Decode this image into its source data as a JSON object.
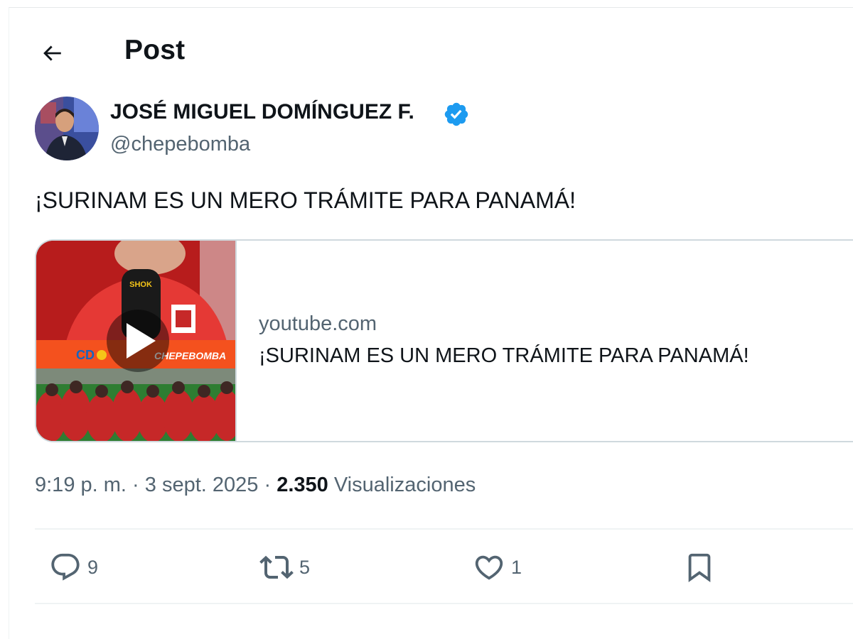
{
  "header": {
    "title": "Post",
    "back_icon": "arrow-left-icon"
  },
  "author": {
    "name": "JOSÉ MIGUEL DOMÍNGUEZ F.",
    "handle": "@chepebomba",
    "verified": true,
    "verified_color": "#1d9bf0"
  },
  "post": {
    "text": "¡SURINAM ES UN MERO TRÁMITE PARA PANAMÁ!"
  },
  "card": {
    "domain": "youtube.com",
    "title": "¡SURINAM ES UN MERO TRÁMITE PARA PANAMÁ!",
    "thumbnail_labels": {
      "mic": "SHOK",
      "banner": "CHEPEBOMBA",
      "logo": "CD"
    },
    "play_icon": "play-icon"
  },
  "meta": {
    "time": "9:19 p. m.",
    "separator": "·",
    "date": "3 sept. 2025",
    "views": "2.350",
    "views_label": "Visualizaciones"
  },
  "actions": {
    "replies": "9",
    "reposts": "5",
    "likes": "1",
    "reply_icon": "reply-icon",
    "repost_icon": "repost-icon",
    "like_icon": "heart-icon",
    "bookmark_icon": "bookmark-icon"
  },
  "colors": {
    "text_primary": "#0f1419",
    "text_secondary": "#536471",
    "border": "#cfd9de",
    "accent": "#1d9bf0"
  }
}
